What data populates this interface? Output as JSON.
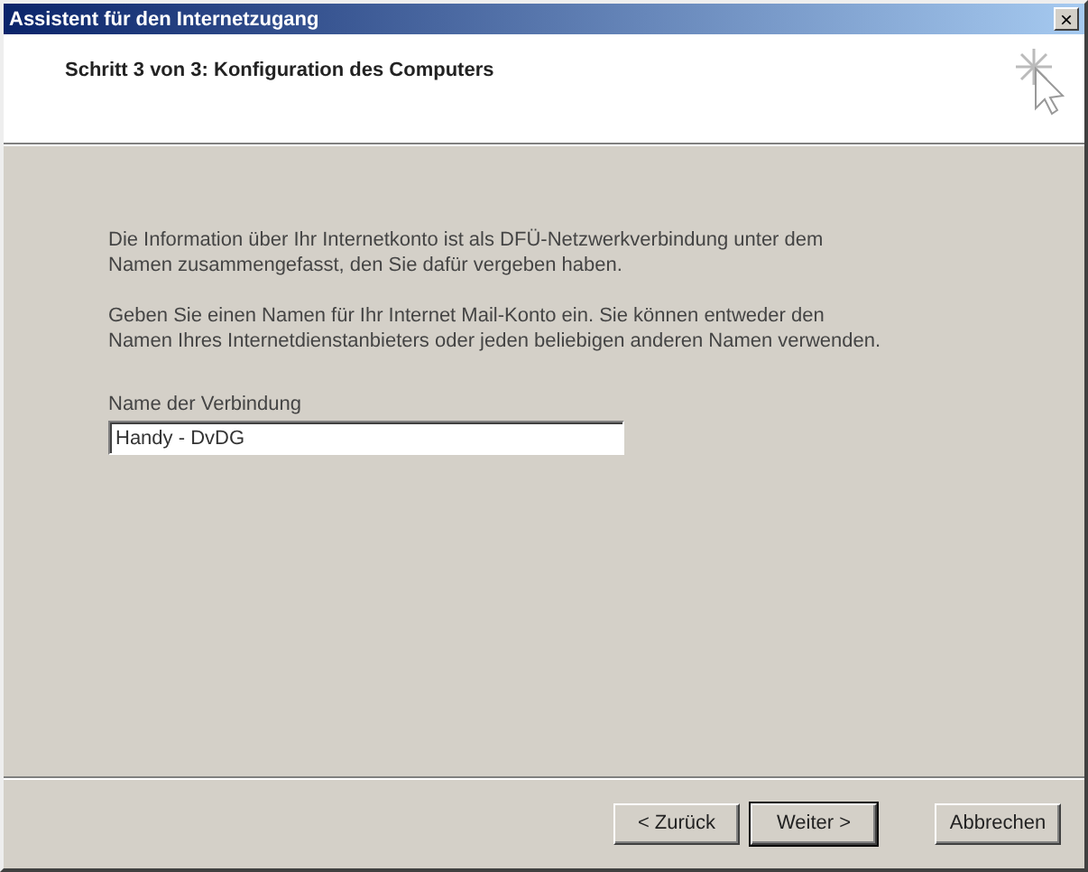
{
  "window": {
    "title": "Assistent für den Internetzugang",
    "close": "×"
  },
  "header": {
    "title": "Schritt 3 von 3: Konfiguration des Computers"
  },
  "paragraphs": [
    "Die Information über Ihr Internetkonto ist als DFÜ-Netzwerkverbindung unter dem\nNamen zusammengefasst, den Sie dafür vergeben haben.",
    "Geben Sie einen Namen für Ihr Internet Mail-Konto ein. Sie können entweder den\nNamen Ihres Internetdienstanbieters oder jeden beliebigen anderen Namen verwenden."
  ],
  "field": {
    "label": "Name der Verbindung",
    "value": "Handy - DvDG"
  },
  "buttons": [
    {
      "label": "< Zurück",
      "default": false
    },
    {
      "label": "Weiter >",
      "default": true
    },
    {
      "label": "Abbrechen",
      "default": false
    }
  ]
}
